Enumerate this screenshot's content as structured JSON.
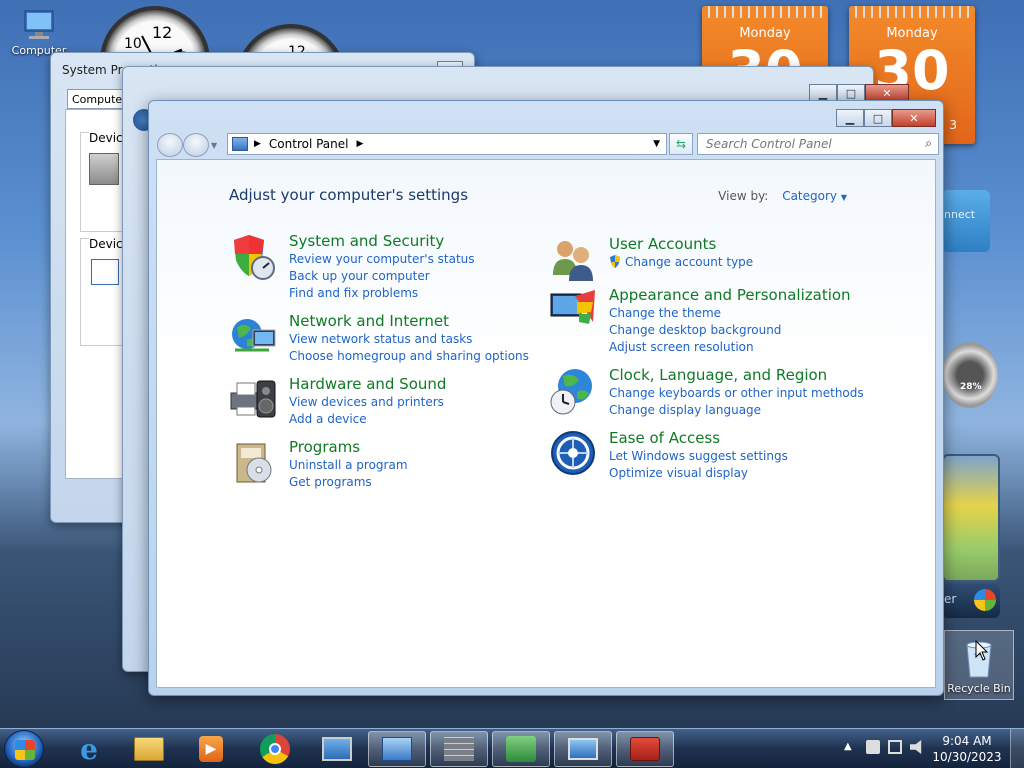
{
  "desktop": {
    "computer_icon_label": "Computer",
    "recycle_bin_label": "Recycle Bin"
  },
  "gadgets": {
    "calendar1": {
      "day": "Monday",
      "date": "30"
    },
    "calendar2": {
      "day": "Monday",
      "date": "30",
      "year_fragment": "3"
    },
    "cpu_meter": "28%",
    "connect_fragment": "nnect",
    "player_fragment": "er"
  },
  "system_properties": {
    "title": "System Properties",
    "close_label": "✕",
    "tab_fragment": "Computer N",
    "section1_fragment": "Device",
    "section2_fragment": "Device"
  },
  "main_window": {
    "breadcrumb": "Control Panel",
    "search_placeholder": "Search Control Panel",
    "heading": "Adjust your computer's settings",
    "view_by_label": "View by:",
    "view_by_value": "Category",
    "left_categories": [
      {
        "title": "System and Security",
        "links": [
          "Review your computer's status",
          "Back up your computer",
          "Find and fix problems"
        ]
      },
      {
        "title": "Network and Internet",
        "links": [
          "View network status and tasks",
          "Choose homegroup and sharing options"
        ]
      },
      {
        "title": "Hardware and Sound",
        "links": [
          "View devices and printers",
          "Add a device"
        ]
      },
      {
        "title": "Programs",
        "links": [
          "Uninstall a program",
          "Get programs"
        ]
      }
    ],
    "right_categories": [
      {
        "title": "User Accounts",
        "links": [
          "Change account type"
        ]
      },
      {
        "title": "Appearance and Personalization",
        "links": [
          "Change the theme",
          "Change desktop background",
          "Adjust screen resolution"
        ]
      },
      {
        "title": "Clock, Language, and Region",
        "links": [
          "Change keyboards or other input methods",
          "Change display language"
        ]
      },
      {
        "title": "Ease of Access",
        "links": [
          "Let Windows suggest settings",
          "Optimize visual display"
        ]
      }
    ]
  },
  "taskbar": {
    "time": "9:04 AM",
    "date": "10/30/2023",
    "items": [
      "internet-explorer",
      "windows-explorer",
      "media-player",
      "chrome",
      "remote-desktop",
      "control-panel",
      "firewall",
      "network",
      "system",
      "toolbox"
    ]
  },
  "colors": {
    "link_blue": "#1f64c6",
    "category_green": "#0f7a25",
    "heading_navy": "#1c3a6b"
  }
}
